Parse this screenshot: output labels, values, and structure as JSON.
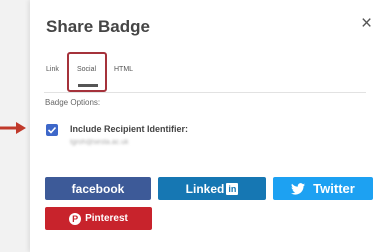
{
  "dialog": {
    "title": "Share Badge",
    "close_symbol": "×"
  },
  "tabs": [
    {
      "label": "Link"
    },
    {
      "label": "Social"
    },
    {
      "label": "HTML"
    }
  ],
  "badge_options": {
    "label": "Badge Options:",
    "include_recipient_label": "Include Recipient Identifier:",
    "recipient_identifier": "tgroh@sesta.ac.uk",
    "checked": true
  },
  "social_buttons": {
    "facebook": "facebook",
    "linkedin_text": "Linked",
    "linkedin_in": "in",
    "twitter": "Twitter",
    "pinterest": "Pinterest"
  },
  "colors": {
    "highlight": "#a5323b",
    "facebook": "#3d5a98",
    "linkedin": "#1677b3",
    "twitter": "#1da1f2",
    "pinterest": "#c8232c",
    "checkbox": "#3d67c9"
  },
  "icons": {
    "arrow": "arrow-right-icon",
    "close": "close-icon",
    "checkbox": "checkmark-icon",
    "twitter": "twitter-bird-icon",
    "pinterest": "pinterest-p-icon"
  }
}
